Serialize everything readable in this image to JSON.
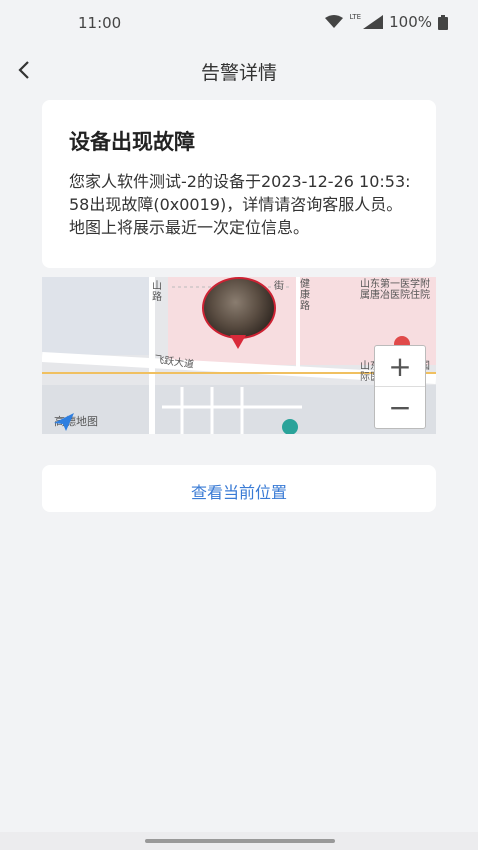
{
  "status_bar": {
    "time": "11:00",
    "network": "LTE",
    "battery": "100%",
    "icons": [
      "wifi-icon",
      "signal-icon",
      "battery-icon"
    ]
  },
  "nav": {
    "back_icon": "chevron-left-icon",
    "title": "告警详情"
  },
  "alert": {
    "title": "设备出现故障",
    "description": "您家人软件测试-2的设备于2023-12-26 10:53:58出现故障(0x0019)，详情请咨询客服人员。地图上将展示最近一次定位信息。"
  },
  "map": {
    "labels": {
      "road_main": "飞跃大道",
      "road_left": "山路",
      "road_top": "街",
      "road_right": "健康路",
      "hospital_1": "山东第一医学附属唐冶医院住院",
      "hospital_2": "山东…医大学国际医",
      "amap": "高德地图"
    },
    "zoom_in_label": "+",
    "zoom_out_label": "−",
    "marker_color": "#d92a3a"
  },
  "actions": {
    "view_location": "查看当前位置"
  },
  "colors": {
    "accent": "#3a7bd5",
    "background": "#f2f3f5"
  }
}
